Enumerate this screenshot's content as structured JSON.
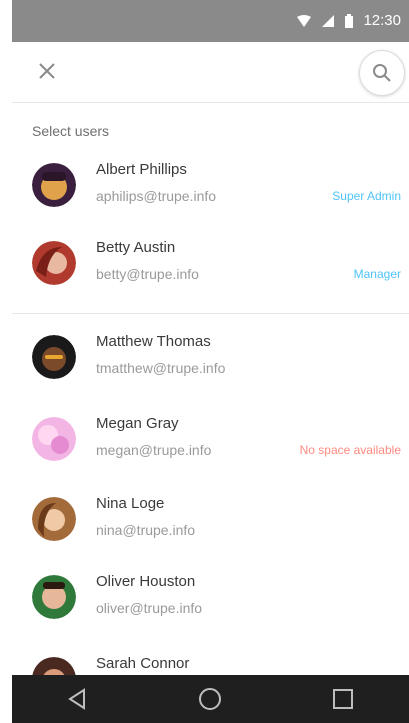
{
  "status_bar": {
    "time": "12:30"
  },
  "app_bar": {
    "close_icon": "close-icon",
    "search_icon": "search-icon"
  },
  "section_label": "Select users",
  "colors": {
    "tag_admin": "#4fc3f7",
    "tag_warning": "#ff8a80",
    "status_bar": "#8a8a8a",
    "nav_bar": "#1f1f1f"
  },
  "users": [
    {
      "name": "Albert Phillips",
      "email": "aphilips@trupe.info",
      "tag": "Super Admin",
      "tag_type": "admin",
      "avatar": "avatar-albert"
    },
    {
      "name": "Betty Austin",
      "email": "betty@trupe.info",
      "tag": "Manager",
      "tag_type": "admin",
      "avatar": "avatar-betty"
    },
    {
      "name": "Matthew Thomas",
      "email": "tmatthew@trupe.info",
      "tag": "",
      "tag_type": "",
      "avatar": "avatar-matthew"
    },
    {
      "name": "Megan Gray",
      "email": "megan@trupe.info",
      "tag": "No space available",
      "tag_type": "warning",
      "avatar": "avatar-megan"
    },
    {
      "name": "Nina Loge",
      "email": "nina@trupe.info",
      "tag": "",
      "tag_type": "",
      "avatar": "avatar-nina"
    },
    {
      "name": "Oliver Houston",
      "email": "oliver@trupe.info",
      "tag": "",
      "tag_type": "",
      "avatar": "avatar-oliver"
    },
    {
      "name": "Sarah Connor",
      "email": "",
      "tag": "",
      "tag_type": "",
      "avatar": "avatar-sarah"
    }
  ],
  "nav": {
    "back_icon": "back-triangle-icon",
    "home_icon": "home-circle-icon",
    "recents_icon": "recents-square-icon"
  }
}
